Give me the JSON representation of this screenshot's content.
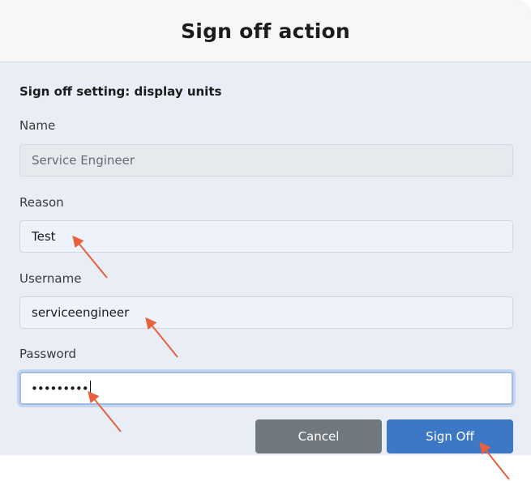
{
  "dialog": {
    "title": "Sign off action",
    "setting_heading": "Sign off setting: display units",
    "fields": {
      "name": {
        "label": "Name",
        "value": "Service Engineer"
      },
      "reason": {
        "label": "Reason",
        "value": "Test"
      },
      "username": {
        "label": "Username",
        "value": "serviceengineer"
      },
      "password": {
        "label": "Password",
        "value": "•••••••••"
      }
    },
    "buttons": {
      "cancel": "Cancel",
      "sign_off": "Sign Off"
    }
  },
  "colors": {
    "dialog_bg": "#e8edf6",
    "header_bg": "#f7f7f7",
    "cancel_button": "#707880",
    "sign_off_button": "#3c78c3",
    "annotation_arrow": "#e8603c"
  }
}
